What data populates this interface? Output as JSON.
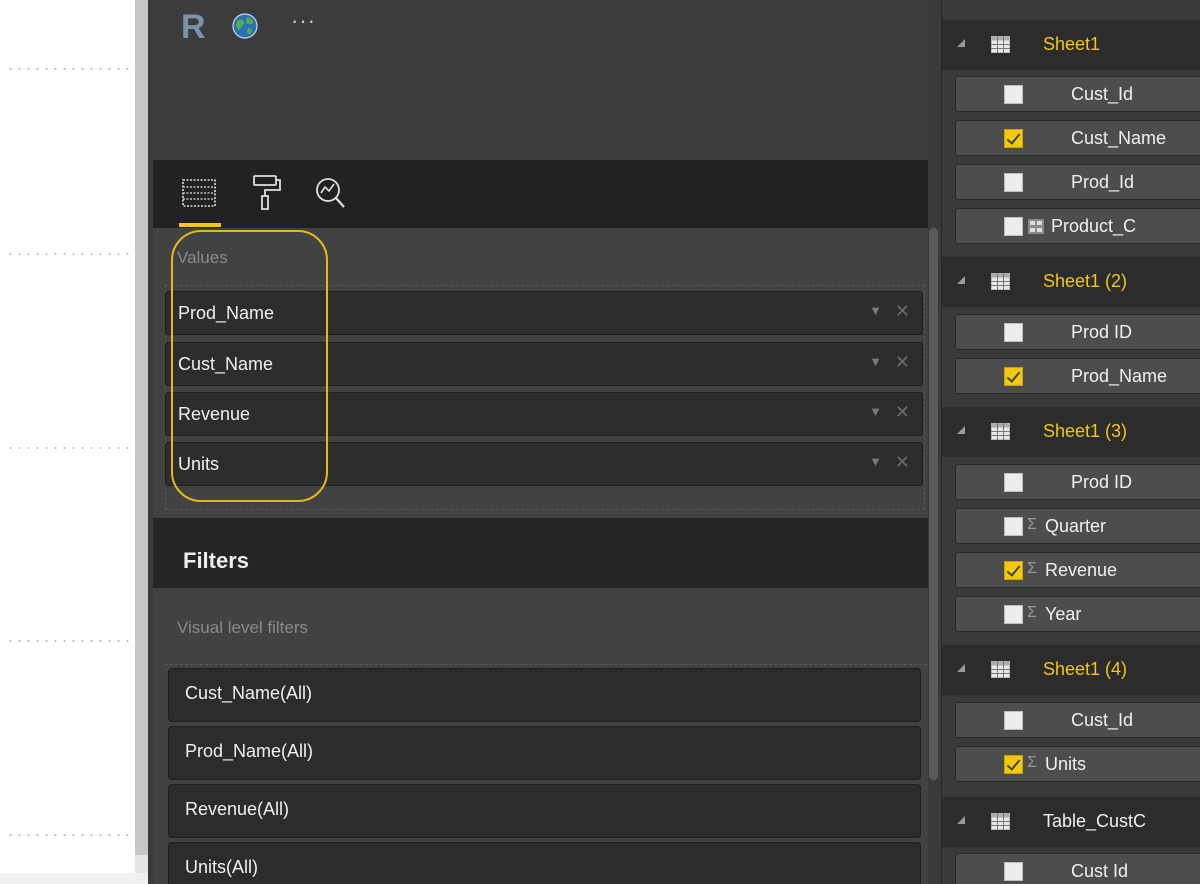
{
  "visualizations": {
    "r_visual_label": "R",
    "values_label": "Values",
    "values": [
      {
        "label": "Prod_Name"
      },
      {
        "label": "Cust_Name"
      },
      {
        "label": "Revenue"
      },
      {
        "label": "Units"
      }
    ],
    "filters_title": "Filters",
    "visual_filters_label": "Visual level filters",
    "filters": [
      {
        "label": "Cust_Name(All)"
      },
      {
        "label": "Prod_Name(All)"
      },
      {
        "label": "Revenue(All)"
      },
      {
        "label": "Units(All)"
      }
    ]
  },
  "fields": {
    "tables": [
      {
        "name": "Sheet1",
        "fields": [
          {
            "name": "Cust_Id",
            "checked": false
          },
          {
            "name": "Cust_Name",
            "checked": true
          },
          {
            "name": "Prod_Id",
            "checked": false
          },
          {
            "name": "Product_C",
            "checked": false,
            "icon": "hierarchy-icon"
          }
        ]
      },
      {
        "name": "Sheet1 (2)",
        "fields": [
          {
            "name": "Prod ID",
            "checked": false
          },
          {
            "name": "Prod_Name",
            "checked": true
          }
        ]
      },
      {
        "name": "Sheet1 (3)",
        "fields": [
          {
            "name": "Prod ID",
            "checked": false
          },
          {
            "name": "Quarter",
            "checked": false,
            "icon": "sigma"
          },
          {
            "name": "Revenue",
            "checked": true,
            "icon": "sigma"
          },
          {
            "name": "Year",
            "checked": false,
            "icon": "sigma"
          }
        ]
      },
      {
        "name": "Sheet1 (4)",
        "fields": [
          {
            "name": "Cust_Id",
            "checked": false
          },
          {
            "name": "Units",
            "checked": true,
            "icon": "sigma"
          }
        ]
      },
      {
        "name": "Table_CustC",
        "fields": [
          {
            "name": "Cust Id",
            "checked": false
          }
        ]
      }
    ]
  },
  "colors": {
    "accent": "#f2c811",
    "highlight": "#e2bb19",
    "pane_bg": "#3b3b3b"
  }
}
